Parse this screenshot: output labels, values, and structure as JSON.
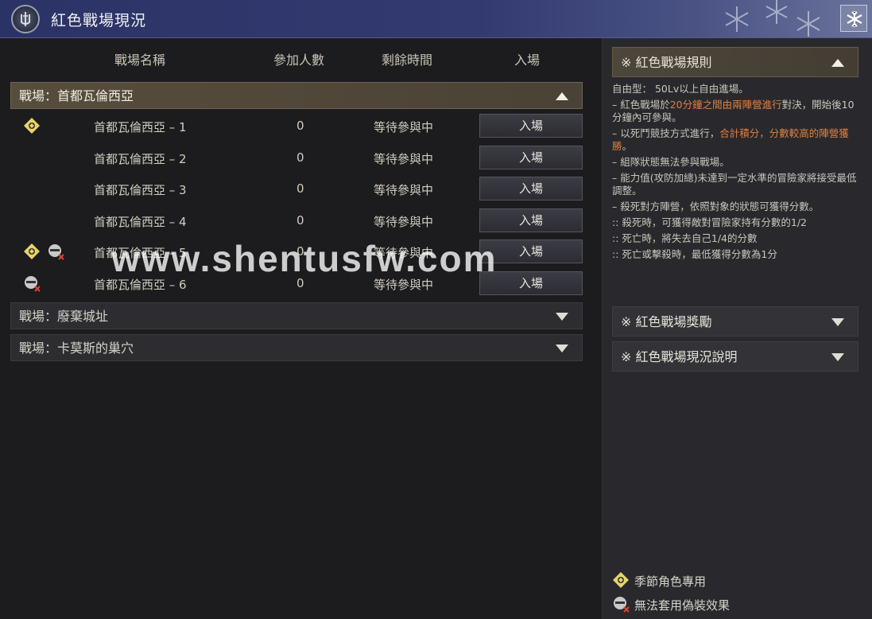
{
  "window": {
    "title": "紅色戰場現況",
    "emblem_icon": "shield-sword-emblem-icon",
    "close_icon": "snowflake-close-icon"
  },
  "columns": {
    "name": "戰場名稱",
    "participants": "參加人數",
    "remaining_time": "剩餘時間",
    "enter": "入場"
  },
  "groups": [
    {
      "label": "戰場：首都瓦倫西亞",
      "expanded": true,
      "rows": [
        {
          "name": "首都瓦倫西亞 – 1",
          "count": "0",
          "status": "等待參與中",
          "button": "入場",
          "season": true,
          "disguise": false
        },
        {
          "name": "首都瓦倫西亞 – 2",
          "count": "0",
          "status": "等待參與中",
          "button": "入場",
          "season": false,
          "disguise": false
        },
        {
          "name": "首都瓦倫西亞 – 3",
          "count": "0",
          "status": "等待參與中",
          "button": "入場",
          "season": false,
          "disguise": false
        },
        {
          "name": "首都瓦倫西亞 – 4",
          "count": "0",
          "status": "等待參與中",
          "button": "入場",
          "season": false,
          "disguise": false
        },
        {
          "name": "首都瓦倫西亞 – 5",
          "count": "0",
          "status": "等待參與中",
          "button": "入場",
          "season": true,
          "disguise": true
        },
        {
          "name": "首都瓦倫西亞 – 6",
          "count": "0",
          "status": "等待參與中",
          "button": "入場",
          "season": false,
          "disguise": true
        }
      ]
    },
    {
      "label": "戰場：廢棄城址",
      "expanded": false
    },
    {
      "label": "戰場：卡莫斯的巢穴",
      "expanded": false
    }
  ],
  "watermark": "www.shentusfw.com",
  "rules_panel": {
    "rules_header": "※ 紅色戰場規則",
    "rules": [
      {
        "parts": [
          {
            "t": "自由型： 50Lv以上自由進場。",
            "hl": false
          }
        ]
      },
      {
        "parts": [
          {
            "t": "– 紅色戰場於",
            "hl": false
          },
          {
            "t": "20分鐘之間由兩陣營進行",
            "hl": true
          },
          {
            "t": "對決，開始後10分鐘內可參與。",
            "hl": false
          }
        ]
      },
      {
        "parts": [
          {
            "t": "– 以死鬥競技方式進行，",
            "hl": false
          },
          {
            "t": "合計積分，分數較高的陣營獲勝",
            "hl": true
          },
          {
            "t": "。",
            "hl": false
          }
        ]
      },
      {
        "parts": [
          {
            "t": "– 組隊狀態無法參與戰場。",
            "hl": false
          }
        ]
      },
      {
        "parts": [
          {
            "t": "– 能力值(攻防加總)未達到一定水準的冒險家將接受最低調整。",
            "hl": false
          }
        ]
      },
      {
        "parts": [
          {
            "t": "– 殺死對方陣營，依照對象的狀態可獲得分數。",
            "hl": false
          }
        ]
      },
      {
        "parts": [
          {
            "t": ":: 殺死時，可獲得敵對冒險家持有分數的1/2",
            "hl": false
          }
        ]
      },
      {
        "parts": [
          {
            "t": ":: 死亡時，將失去自己1/4的分數",
            "hl": false
          }
        ]
      },
      {
        "parts": [
          {
            "t": ":: 死亡或擊殺時，最低獲得分數為1分",
            "hl": false
          }
        ]
      }
    ],
    "reward_header": "※ 紅色戰場獎勵",
    "status_header": "※ 紅色戰場現況說明"
  },
  "legend": {
    "season_label": "季節角色專用",
    "disguise_label": "無法套用偽裝效果"
  },
  "colors": {
    "title_bar": "#2b3366",
    "highlight": "#e0803f",
    "season_badge": "#e7d46a"
  }
}
